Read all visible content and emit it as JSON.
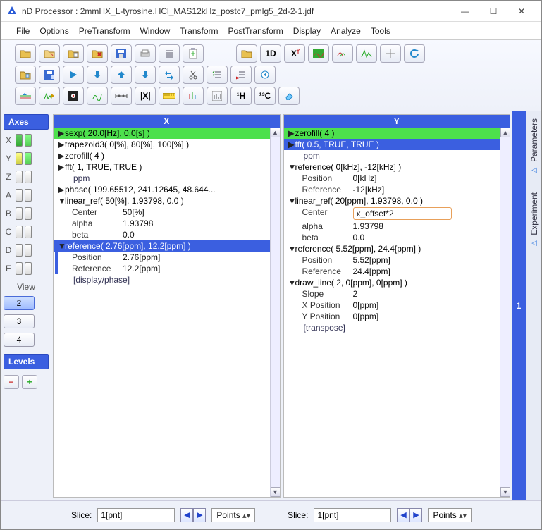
{
  "window": {
    "title": "nD Processor : 2mmHX_L-tyrosine.HCl_MAS12kHz_postc7_pmlg5_2d-2-1.jdf"
  },
  "menu": [
    "File",
    "Options",
    "PreTransform",
    "Window",
    "Transform",
    "PostTransform",
    "Display",
    "Analyze",
    "Tools"
  ],
  "toolbar_text": {
    "oneD": "1D",
    "h": "¹H",
    "c": "¹³C"
  },
  "axes": {
    "header": "Axes",
    "rows": [
      {
        "label": "X"
      },
      {
        "label": "Y"
      },
      {
        "label": "Z"
      },
      {
        "label": "A"
      },
      {
        "label": "B"
      },
      {
        "label": "C"
      },
      {
        "label": "D"
      },
      {
        "label": "E"
      }
    ],
    "view_header": "View",
    "views": [
      "2",
      "3",
      "4"
    ],
    "levels_header": "Levels"
  },
  "sidetabs": {
    "params": "Parameters",
    "exp": "Experiment"
  },
  "rightstrip": "1",
  "paneX": {
    "header": "X",
    "items": [
      {
        "type": "hdr",
        "style": "green",
        "text": "sexp( 20.0[Hz], 0.0[s] )"
      },
      {
        "type": "hdr",
        "tri": "▶",
        "text": "trapezoid3( 0[%], 80[%], 100[%] )"
      },
      {
        "type": "hdr",
        "tri": "▶",
        "text": "zerofill( 4 )"
      },
      {
        "type": "hdr",
        "tri": "▶",
        "text": "fft( 1, TRUE, TRUE )"
      },
      {
        "type": "plain",
        "text": "ppm"
      },
      {
        "type": "hdr",
        "tri": "▶",
        "text": "phase( 199.65512, 241.12645, 48.644..."
      },
      {
        "type": "hdr",
        "tri": "▼",
        "text": "linear_ref( 50[%], 1.93798, 0.0 )"
      },
      {
        "type": "kv",
        "k": "Center",
        "v": "50[%]"
      },
      {
        "type": "kv",
        "k": "alpha",
        "v": "1.93798"
      },
      {
        "type": "kv",
        "k": "beta",
        "v": "0.0"
      },
      {
        "type": "sel",
        "tri": "▼",
        "text": "reference( 2.76[ppm], 12.2[ppm] )"
      },
      {
        "type": "kv",
        "k": "Position",
        "v": "2.76[ppm]",
        "bar": true
      },
      {
        "type": "kv",
        "k": "Reference",
        "v": "12.2[ppm]",
        "bar": true
      },
      {
        "type": "plain",
        "text": "[display/phase]"
      }
    ]
  },
  "paneY": {
    "header": "Y",
    "items": [
      {
        "type": "hdr",
        "tri": "▶",
        "text": "zerofill( 4 )",
        "style": "green"
      },
      {
        "type": "hdr",
        "tri": "▶",
        "text": "fft( 0.5, TRUE, TRUE )",
        "style": "blue"
      },
      {
        "type": "plain",
        "text": "ppm"
      },
      {
        "type": "hdr",
        "tri": "▼",
        "text": "reference( 0[kHz], -12[kHz] )"
      },
      {
        "type": "kv",
        "k": "Position",
        "v": "0[kHz]"
      },
      {
        "type": "kv",
        "k": "Reference",
        "v": "-12[kHz]"
      },
      {
        "type": "hdr",
        "tri": "▼",
        "text": "linear_ref( 20[ppm], 1.93798, 0.0 )"
      },
      {
        "type": "kvinput",
        "k": "Center",
        "v": "x_offset*2"
      },
      {
        "type": "kv",
        "k": "alpha",
        "v": "1.93798"
      },
      {
        "type": "kv",
        "k": "beta",
        "v": "0.0"
      },
      {
        "type": "hdr",
        "tri": "▼",
        "text": "reference( 5.52[ppm], 24.4[ppm] )"
      },
      {
        "type": "kv",
        "k": "Position",
        "v": "5.52[ppm]"
      },
      {
        "type": "kv",
        "k": "Reference",
        "v": "24.4[ppm]"
      },
      {
        "type": "hdr",
        "tri": "▼",
        "text": "draw_line( 2, 0[ppm], 0[ppm] )"
      },
      {
        "type": "kv",
        "k": "Slope",
        "v": "2"
      },
      {
        "type": "kv",
        "k": "X Position",
        "v": "0[ppm]"
      },
      {
        "type": "kv",
        "k": "Y Position",
        "v": "0[ppm]"
      },
      {
        "type": "plain",
        "text": "[transpose]"
      }
    ]
  },
  "bottom": {
    "slice_label": "Slice:",
    "slice_value": "1[pnt]",
    "points_label": "Points"
  }
}
